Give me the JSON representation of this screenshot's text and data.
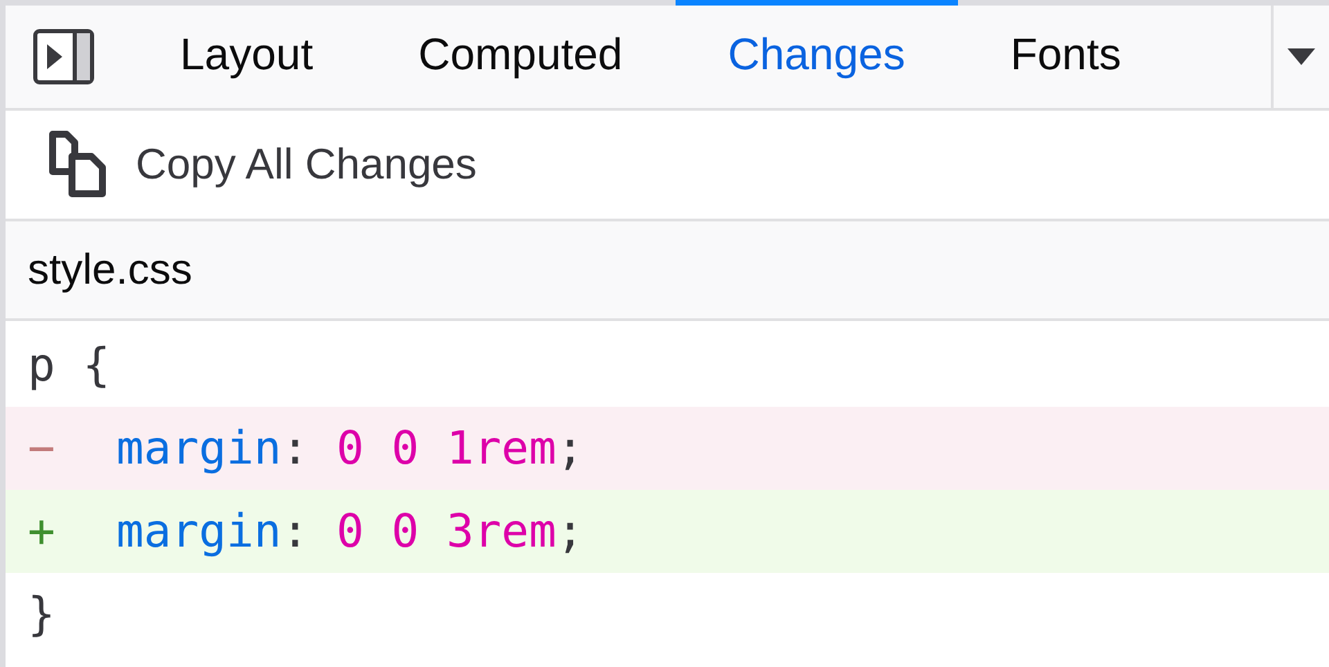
{
  "tabs": [
    {
      "label": "Layout",
      "selected": false
    },
    {
      "label": "Computed",
      "selected": false
    },
    {
      "label": "Changes",
      "selected": true
    },
    {
      "label": "Fonts",
      "selected": false
    }
  ],
  "toolbar": {
    "copy_button": "Copy All Changes"
  },
  "file": {
    "name": "style.css"
  },
  "lines": [
    {
      "kind": "context",
      "tokens": [
        {
          "kind": "plain",
          "text": "p {"
        }
      ]
    },
    {
      "kind": "removed",
      "marker": "−",
      "tokens": [
        {
          "kind": "property",
          "text": "margin"
        },
        {
          "kind": "punct",
          "text": ": "
        },
        {
          "kind": "value",
          "text": "0 0 1rem"
        },
        {
          "kind": "punct",
          "text": ";"
        }
      ]
    },
    {
      "kind": "added",
      "marker": "+",
      "tokens": [
        {
          "kind": "property",
          "text": "margin"
        },
        {
          "kind": "punct",
          "text": ": "
        },
        {
          "kind": "value",
          "text": "0 0 3rem"
        },
        {
          "kind": "punct",
          "text": ";"
        }
      ]
    },
    {
      "kind": "context",
      "tokens": [
        {
          "kind": "plain",
          "text": "}"
        }
      ]
    }
  ]
}
